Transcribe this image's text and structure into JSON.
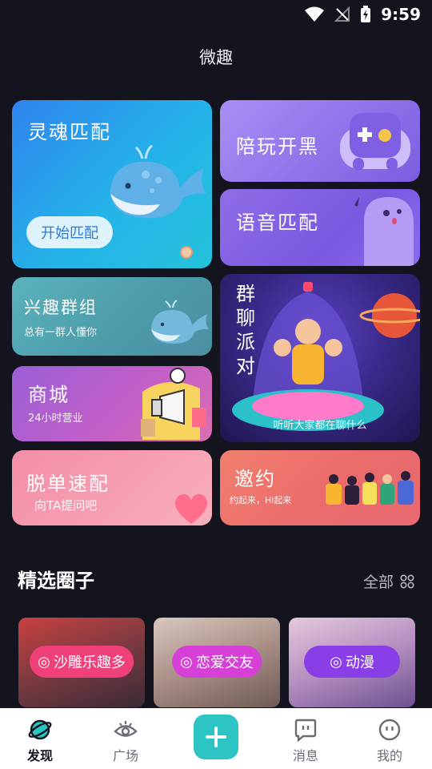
{
  "status_bar": {
    "time": "9:59"
  },
  "app_title": "微趣",
  "cards": {
    "soul": {
      "title": "灵魂匹配",
      "button": "开始匹配"
    },
    "game": {
      "title": "陪玩开黑"
    },
    "voice": {
      "title": "语音匹配"
    },
    "group": {
      "title": "兴趣群组",
      "subtitle": "总有一群人懂你"
    },
    "party": {
      "title_chars": [
        "群",
        "聊",
        "派",
        "对"
      ],
      "subtitle": "听听大家都在聊什么"
    },
    "mall": {
      "title": "商城",
      "subtitle": "24小时营业"
    },
    "single": {
      "title": "脱单速配",
      "subtitle": "向TA提问吧"
    },
    "invite": {
      "title": "邀约",
      "subtitle": "约起来，Hi起来"
    }
  },
  "featured": {
    "title": "精选圈子",
    "see_all": "全部",
    "circles": [
      {
        "label": "沙雕乐趣多",
        "color": "#f0407a"
      },
      {
        "label": "恋爱交友",
        "color": "#d640d6"
      },
      {
        "label": "动漫",
        "color": "#8a3ee6"
      }
    ]
  },
  "tabs": [
    {
      "label": "发现",
      "icon": "planet-icon",
      "active": true
    },
    {
      "label": "广场",
      "icon": "eye-icon",
      "active": false
    },
    {
      "label": "消息",
      "icon": "chat-icon",
      "active": false
    },
    {
      "label": "我的",
      "icon": "face-icon",
      "active": false
    }
  ],
  "colors": {
    "accent": "#2cc3c3",
    "background": "#14141f"
  }
}
